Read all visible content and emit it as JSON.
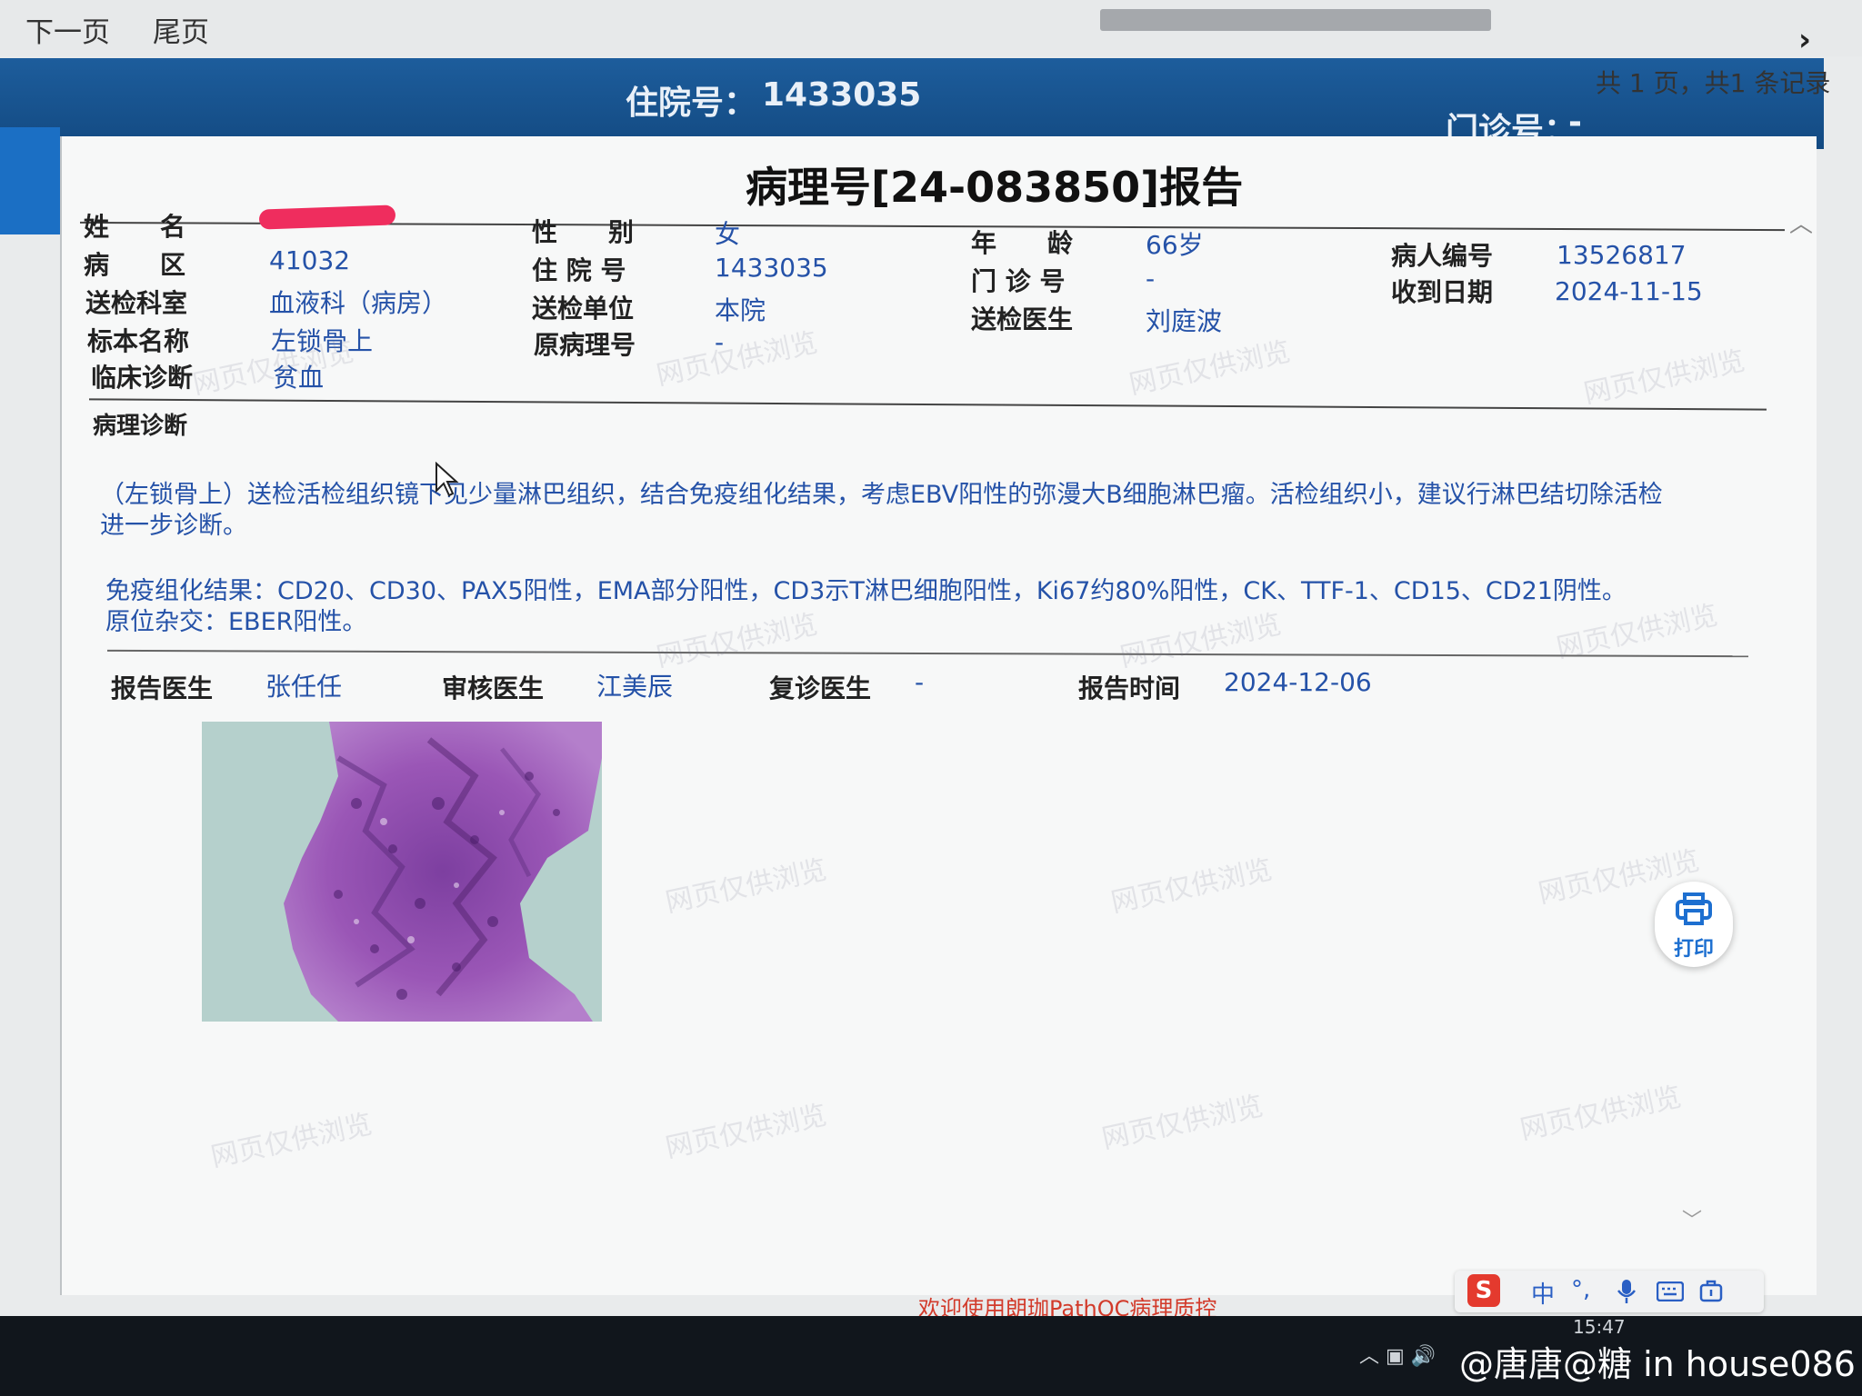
{
  "nav": {
    "next_page": "下一页",
    "last_page": "尾页",
    "page_count": "共 1 页，共1 条记录"
  },
  "header": {
    "inpatient_label": "住院号：",
    "inpatient_no": "1433035",
    "outpatient_label": "门诊号：",
    "outpatient_no": "-"
  },
  "report": {
    "title": "病理号[24-083850]报告",
    "fields": {
      "name_label": "姓　　名",
      "ward_label": "病　　区",
      "ward": "41032",
      "dept_label": "送检科室",
      "dept": "血液科（病房）",
      "specimen_label": "标本名称",
      "specimen": "左锁骨上",
      "clinical_label": "临床诊断",
      "clinical": "贫血",
      "sex_label": "性　　别",
      "sex": "女",
      "admission_label": "住 院 号",
      "admission": "1433035",
      "unit_label": "送检单位",
      "unit": "本院",
      "orig_label": "原病理号",
      "orig": "-",
      "age_label": "年　　龄",
      "age": "66岁",
      "outpatient_label": "门 诊 号",
      "outpatient": "-",
      "doctor_label": "送检医生",
      "doctor": "刘庭波",
      "patient_id_label": "病人编号",
      "patient_id": "13526817",
      "received_label": "收到日期",
      "received": "2024-11-15"
    },
    "diagnosis_label": "病理诊断",
    "diagnosis_line1": "（左锁骨上）送检活检组织镜下见少量淋巴组织，结合免疫组化结果，考虑EBV阳性的弥漫大B细胞淋巴瘤。活检组织小，建议行淋巴结切除活检",
    "diagnosis_line2": "进一步诊断。",
    "ihc_line1": "免疫组化结果：CD20、CD30、PAX5阳性，EMA部分阳性，CD3示T淋巴细胞阳性，Ki67约80%阳性，CK、TTF-1、CD15、CD21阴性。",
    "ihc_line2": "原位杂交：EBER阳性。",
    "sign": {
      "report_doctor_label": "报告医生",
      "report_doctor": "张任任",
      "review_doctor_label": "审核医生",
      "review_doctor": "江美辰",
      "recheck_label": "复诊医生",
      "recheck": "-",
      "report_time_label": "报告时间",
      "report_time": "2024-12-06"
    }
  },
  "print_button": "打印",
  "watermark": "网页仅供浏览",
  "footer": "欢迎使用朗珈PathQC病理质控",
  "ime": {
    "logo": "S",
    "mode": "中",
    "punct": "°,"
  },
  "taskbar": {
    "time": "15:47"
  },
  "credit": "@唐唐@糖 in house086",
  "colors": {
    "header_blue": "#1a5592",
    "value_blue": "#2552a8",
    "footer_red": "#d23a2a"
  }
}
